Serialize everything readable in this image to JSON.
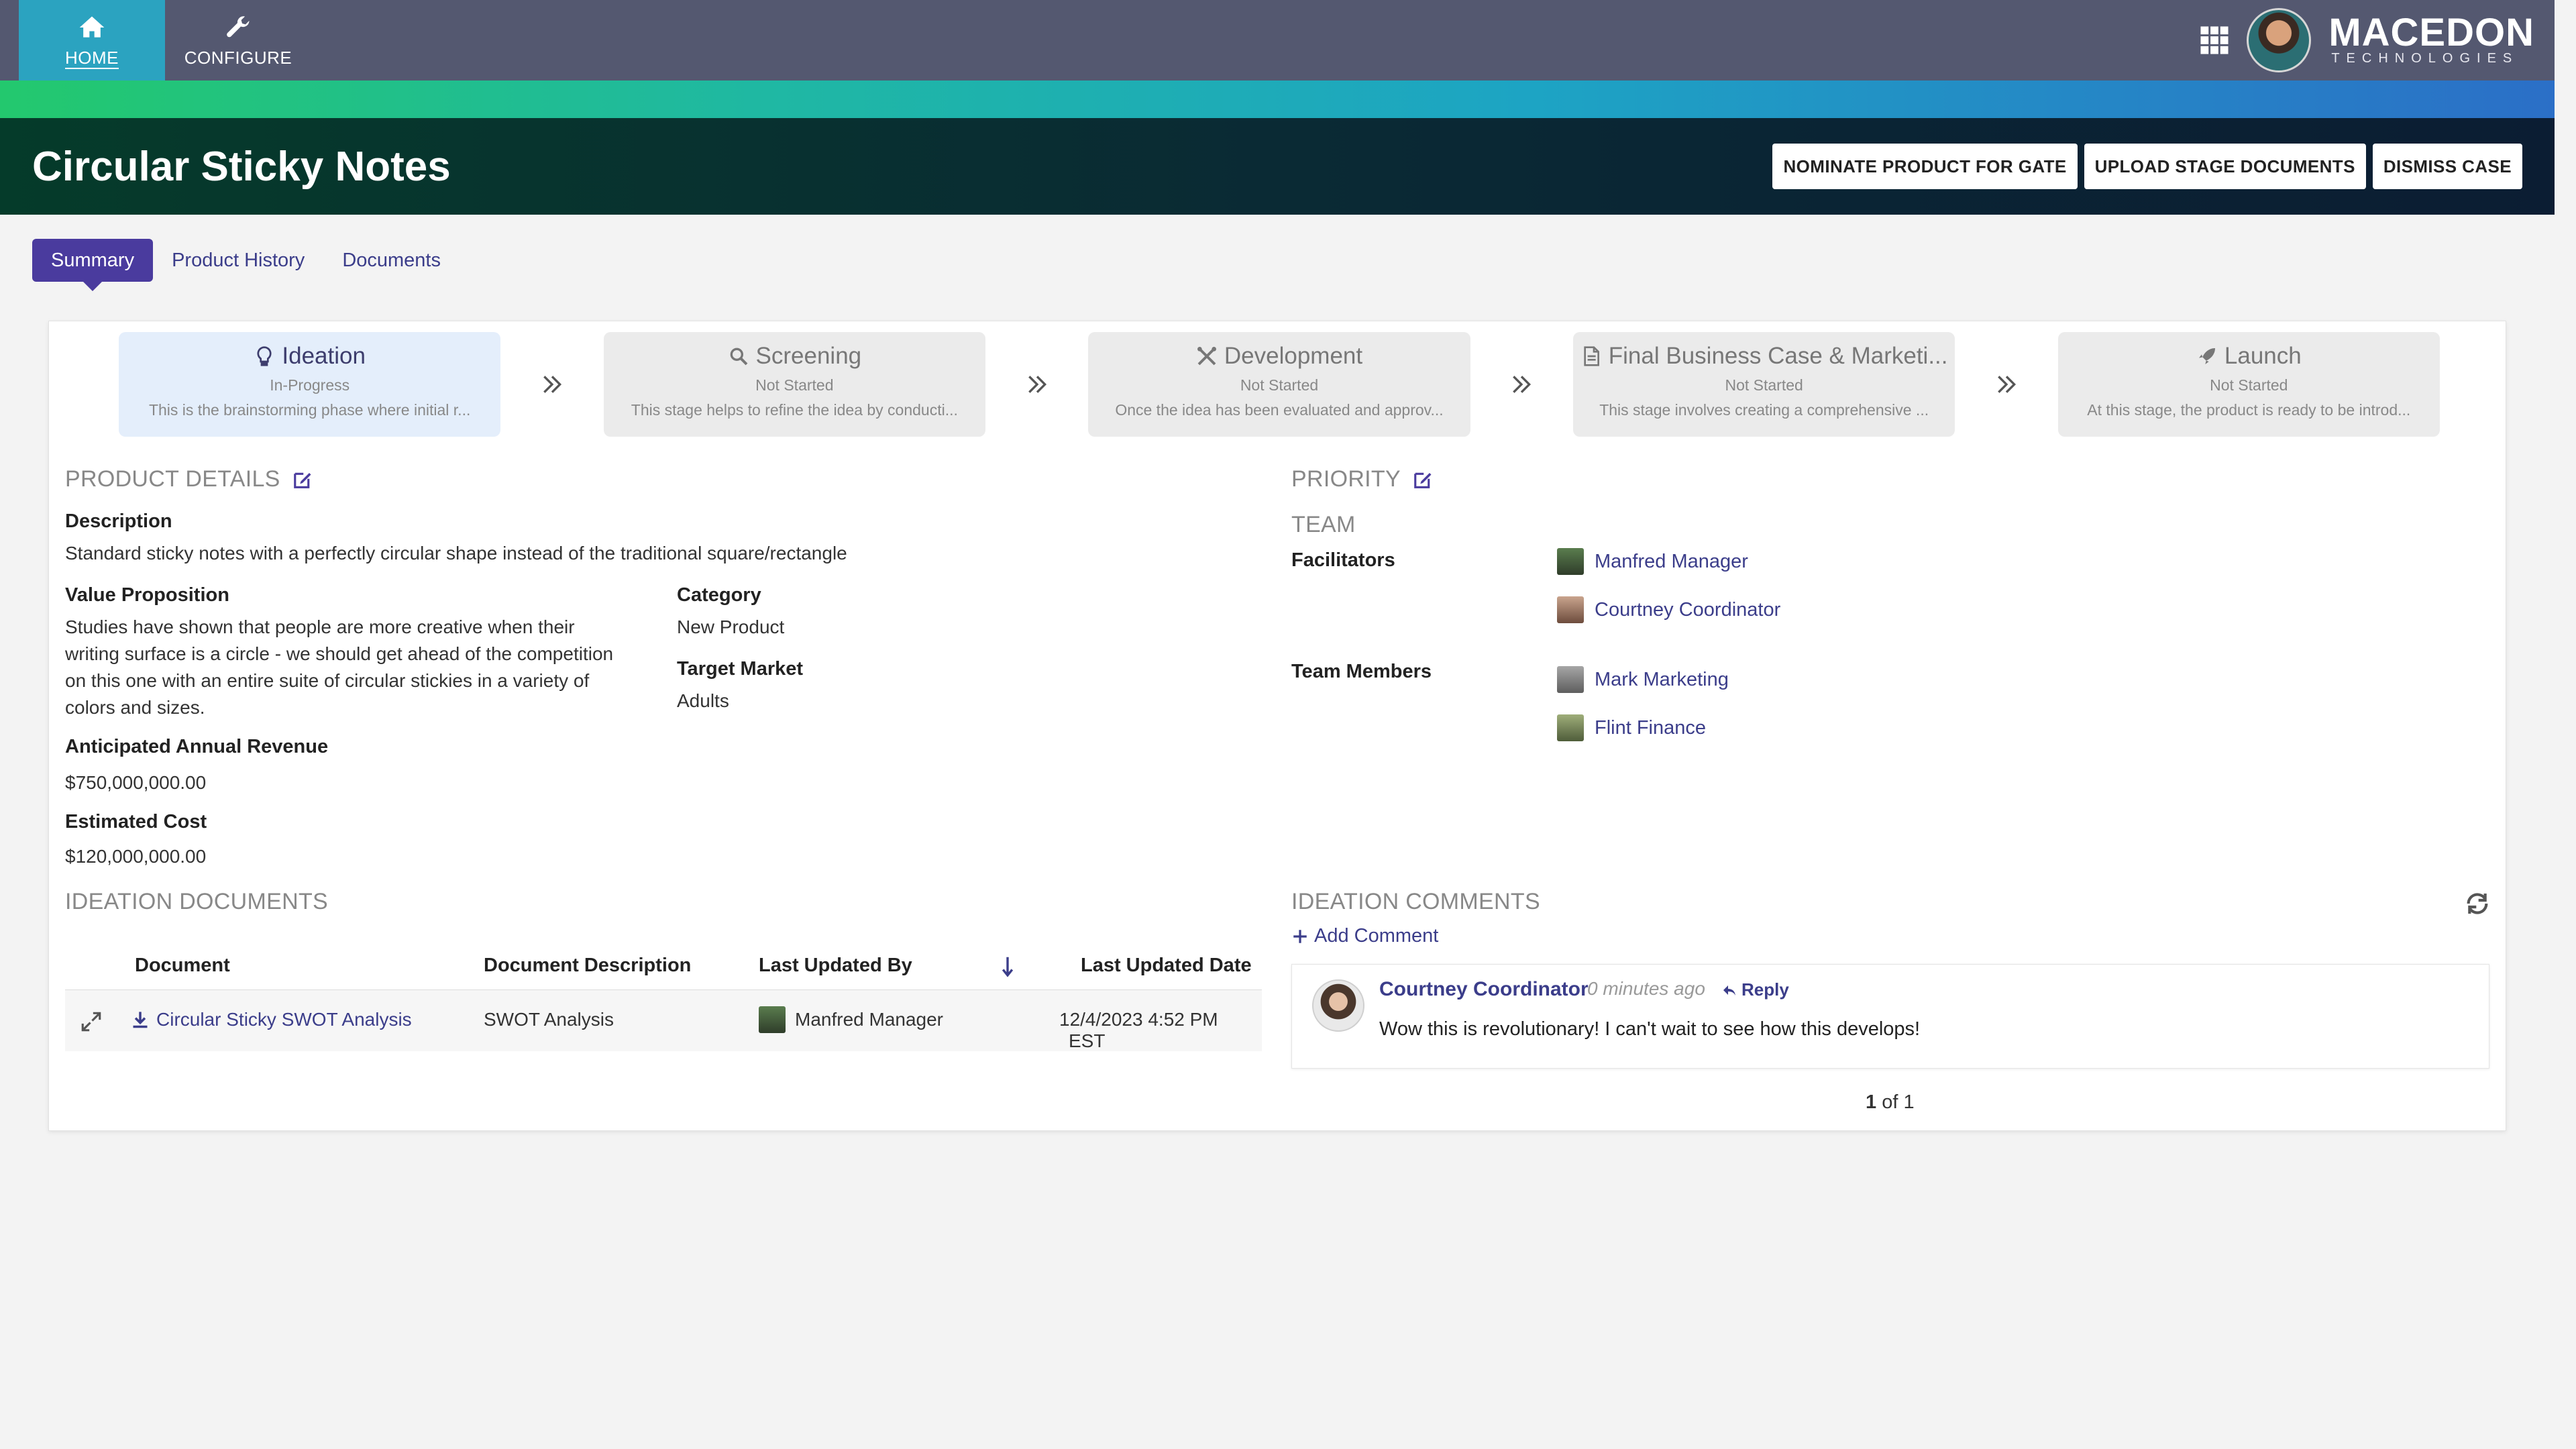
{
  "nav": {
    "items": [
      {
        "label": "HOME",
        "icon": "home-icon",
        "active": true
      },
      {
        "label": "CONFIGURE",
        "icon": "wrench-icon",
        "active": false
      }
    ],
    "brand_name": "MACEDON",
    "brand_sub": "TECHNOLOGIES"
  },
  "header": {
    "title": "Circular Sticky Notes",
    "buttons": [
      "NOMINATE PRODUCT FOR GATE",
      "UPLOAD STAGE DOCUMENTS",
      "DISMISS CASE"
    ]
  },
  "tabs": [
    "Summary",
    "Product History",
    "Documents"
  ],
  "stages": [
    {
      "name": "Ideation",
      "icon": "lightbulb-icon",
      "status": "In-Progress",
      "desc": "This is the brainstorming phase where initial r..."
    },
    {
      "name": "Screening",
      "icon": "magnifier-icon",
      "status": "Not Started",
      "desc": "This stage helps to refine the idea by conducti..."
    },
    {
      "name": "Development",
      "icon": "tools-icon",
      "status": "Not Started",
      "desc": "Once the idea has been evaluated and approv..."
    },
    {
      "name": "Final Business Case & Marketi...",
      "icon": "document-icon",
      "status": "Not Started",
      "desc": "This stage involves creating a comprehensive ..."
    },
    {
      "name": "Launch",
      "icon": "rocket-icon",
      "status": "Not Started",
      "desc": "At this stage, the product is ready to be introd..."
    }
  ],
  "details": {
    "section_title": "PRODUCT DETAILS",
    "description_label": "Description",
    "description": "Standard sticky notes with a perfectly circular shape instead of the traditional square/rectangle",
    "value_prop_label": "Value Proposition",
    "value_prop_lines": [
      "Studies have shown that people are more creative when their",
      "writing surface is a circle - we should get ahead of the competition",
      "on this one with an entire suite of circular stickies in a variety of",
      "colors and sizes."
    ],
    "category_label": "Category",
    "category": "New Product",
    "target_label": "Target Market",
    "target": "Adults",
    "revenue_label": "Anticipated Annual Revenue",
    "revenue": "$750,000,000.00",
    "cost_label": "Estimated Cost",
    "cost": "$120,000,000.00"
  },
  "priority": {
    "title": "PRIORITY"
  },
  "team": {
    "title": "TEAM",
    "facilitators_label": "Facilitators",
    "facilitators": [
      "Manfred Manager",
      "Courtney Coordinator"
    ],
    "members_label": "Team Members",
    "members": [
      "Mark Marketing",
      "Flint Finance"
    ]
  },
  "documents": {
    "title": "IDEATION DOCUMENTS",
    "columns": [
      "Document",
      "Document Description",
      "Last Updated By",
      "Last Updated Date"
    ],
    "rows": [
      {
        "document": "Circular Sticky SWOT Analysis",
        "description": "SWOT Analysis",
        "updated_by": "Manfred Manager",
        "updated_date": "12/4/2023 4:52 PM",
        "tz": "EST"
      }
    ]
  },
  "comments": {
    "title": "IDEATION COMMENTS",
    "add_label": "Add Comment",
    "items": [
      {
        "author": "Courtney Coordinator",
        "time": "0 minutes ago",
        "reply": "Reply",
        "text": "Wow this is revolutionary! I can't wait to see how this develops!"
      }
    ],
    "page_current": "1",
    "page_rest": "of 1"
  },
  "colors": {
    "nav_bg": "#545870",
    "nav_active": "#2ba3c0",
    "accent": "#4a3b9e",
    "link": "#3b3d8a"
  }
}
